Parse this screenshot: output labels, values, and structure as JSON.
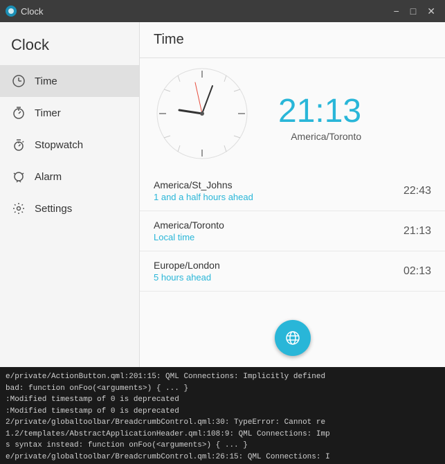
{
  "titlebar": {
    "title": "Clock",
    "icon_color": "#1b8fb5",
    "minimize_label": "−",
    "maximize_label": "□",
    "close_label": "✕"
  },
  "sidebar": {
    "app_title": "Clock",
    "items": [
      {
        "id": "time",
        "label": "Time",
        "icon": "clock"
      },
      {
        "id": "timer",
        "label": "Timer",
        "icon": "timer"
      },
      {
        "id": "stopwatch",
        "label": "Stopwatch",
        "icon": "stopwatch"
      },
      {
        "id": "alarm",
        "label": "Alarm",
        "icon": "alarm"
      },
      {
        "id": "settings",
        "label": "Settings",
        "icon": "settings"
      }
    ]
  },
  "content": {
    "header": "Time",
    "digital_time": "21:13",
    "timezone": "America/Toronto",
    "worldclocks": [
      {
        "name": "America/St_Johns",
        "desc": "1 and a half hours ahead",
        "time": "22:43"
      },
      {
        "name": "America/Toronto",
        "desc": "Local time",
        "time": "21:13"
      },
      {
        "name": "Europe/London",
        "desc": "5 hours ahead",
        "time": "02:13"
      }
    ],
    "add_btn_icon": "🌐"
  },
  "console": {
    "lines": [
      "e/private/ActionButton.qml:201:15: QML Connections: Implicitly defined",
      "bad: function onFoo(<arguments>) { ... }",
      ":Modified timestamp of 0 is deprecated",
      ":Modified timestamp of 0 is deprecated",
      "2/private/globaltoolbar/BreadcrumbControl.qml:30: TypeError: Cannot re",
      "1.2/templates/AbstractApplicationHeader.qml:108:9: QML Connections: Imp",
      "s syntax instead: function onFoo(<arguments>) { ... }",
      "e/private/globaltoolbar/BreadcrumbControl.qml:26:15: QML Connections: I"
    ]
  }
}
